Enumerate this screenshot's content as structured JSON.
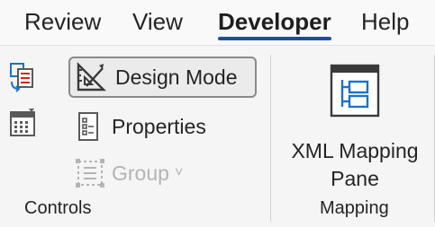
{
  "tabs": [
    {
      "label": "Review",
      "active": false
    },
    {
      "label": "View",
      "active": false
    },
    {
      "label": "Developer",
      "active": true
    },
    {
      "label": "Help",
      "active": false
    }
  ],
  "groups": {
    "controls": {
      "label": "Controls",
      "buttons": {
        "design_mode": {
          "label": "Design Mode",
          "state": "pressed",
          "icon": "design-mode-icon"
        },
        "properties": {
          "label": "Properties",
          "icon": "properties-icon"
        },
        "group": {
          "label": "Group",
          "state": "disabled",
          "icon": "group-icon",
          "chevron": "˅"
        }
      },
      "small_icons": [
        "building-block-icon",
        "date-picker-icon"
      ]
    },
    "mapping": {
      "label": "Mapping",
      "xml_mapping_pane": {
        "line1": "XML Mapping",
        "line2": "Pane",
        "icon": "xml-mapping-pane-icon"
      }
    }
  },
  "colors": {
    "accent": "#1e4e9c",
    "icon_blue": "#1a73c8",
    "icon_red": "#c42b1c",
    "disabled": "#b4b4b4"
  }
}
